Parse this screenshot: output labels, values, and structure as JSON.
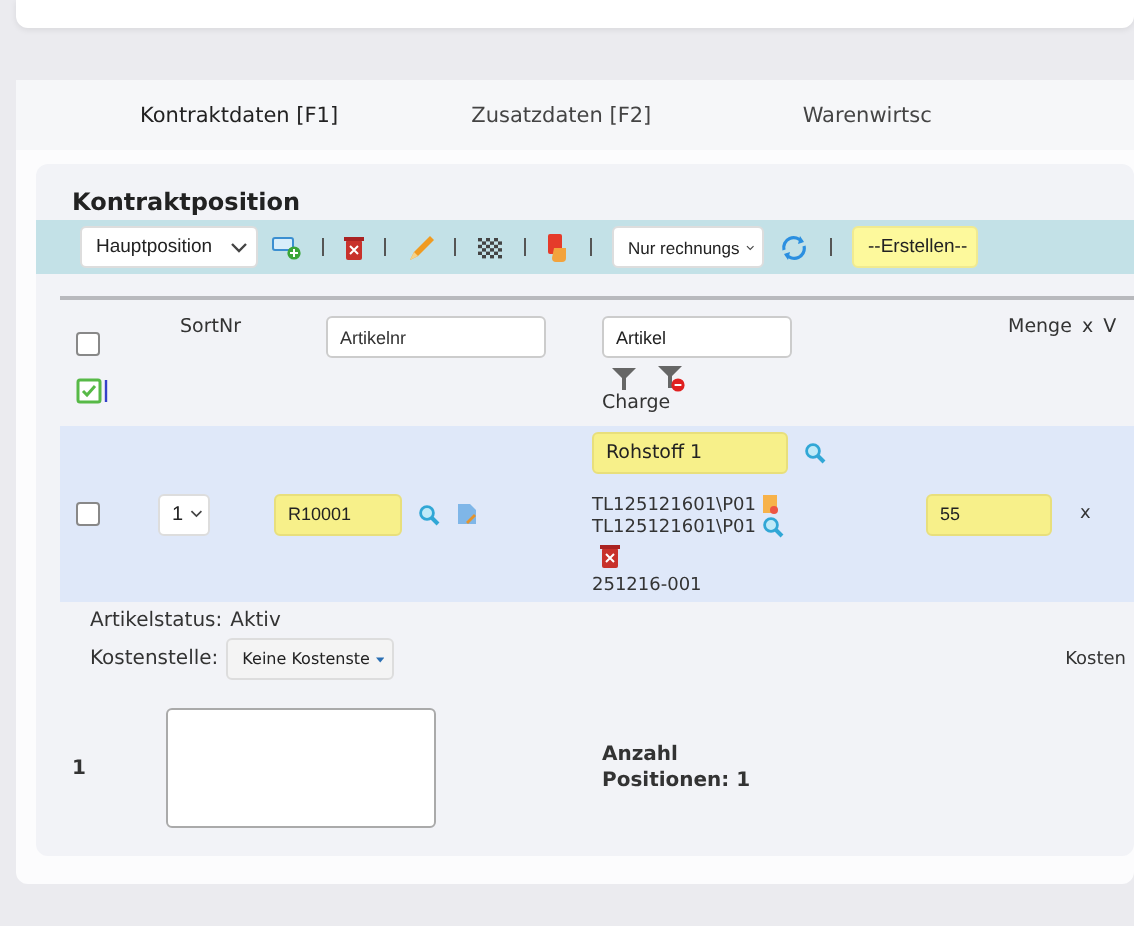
{
  "tabs": [
    {
      "label": "Kontraktdaten [F1]",
      "selected": true
    },
    {
      "label": "Zusatzdaten [F2]",
      "selected": false
    },
    {
      "label": "Warenwirtsc",
      "selected": false
    }
  ],
  "section": {
    "title": "Kontraktposition"
  },
  "toolbar": {
    "position_select": "Hauptposition",
    "filter_select": "Nur rechnungs",
    "create_select": "--Erstellen--"
  },
  "header": {
    "select_all_checked": false,
    "sort_label": "SortNr",
    "article_no_placeholder": "Artikelnr",
    "article_placeholder": "Artikel",
    "batch_label": "Charge",
    "quantity_label": "Menge",
    "times": "x",
    "column_7": "V"
  },
  "rows": [
    {
      "checked": false,
      "sort": "1",
      "article_no": "R10001",
      "article": "Rohstoff 1",
      "batches": [
        "TL125121601\\P01",
        "TL125121601\\P01"
      ],
      "batch_no": "251216-001",
      "quantity": "55",
      "times": "x",
      "status_label": "Artikelstatus:",
      "status": "Aktiv",
      "cost_center_label": "Kostenstelle:",
      "cost_center": "Keine Kostenste",
      "column_8": "Kosten"
    }
  ],
  "footer": {
    "count": "1",
    "summary": "Anzahl Positionen: 1"
  }
}
